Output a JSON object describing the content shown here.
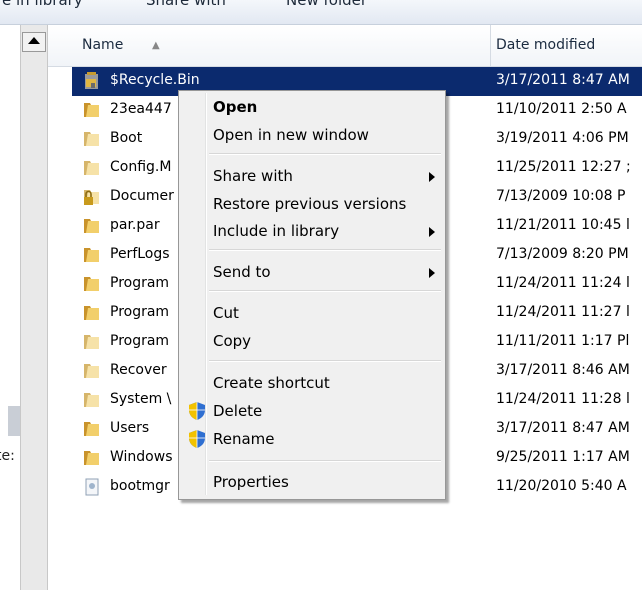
{
  "toolbar": {
    "items": [
      "e in library",
      "Share with",
      "New folder"
    ]
  },
  "left_panel": {
    "cut_text": "te:"
  },
  "header": {
    "name_label": "Name",
    "date_label": "Date modified"
  },
  "files": [
    {
      "name": "$Recycle.Bin",
      "date": "3/17/2011 8:47 AM",
      "icon": "recycle-folder-icon",
      "selected": true
    },
    {
      "name": "23ea447",
      "date": "11/10/2011 2:50 A",
      "icon": "folder-icon"
    },
    {
      "name": "Boot",
      "date": "3/19/2011 4:06 PM",
      "icon": "folder-icon"
    },
    {
      "name": "Config.M",
      "date": "11/25/2011 12:27 ;",
      "icon": "folder-icon"
    },
    {
      "name": "Documer",
      "date": "7/13/2009 10:08 P",
      "icon": "locked-folder-icon"
    },
    {
      "name": "par.par",
      "date": "11/21/2011 10:45 l",
      "icon": "folder-icon"
    },
    {
      "name": "PerfLogs",
      "date": "7/13/2009 8:20 PM",
      "icon": "folder-icon"
    },
    {
      "name": "Program",
      "date": "11/24/2011 11:24 l",
      "icon": "folder-icon"
    },
    {
      "name": "Program",
      "date": "11/24/2011 11:27 l",
      "icon": "folder-icon"
    },
    {
      "name": "Program",
      "date": "11/11/2011 1:17 Pl",
      "icon": "folder-icon"
    },
    {
      "name": "Recover",
      "date": "3/17/2011 8:46 AM",
      "icon": "folder-icon"
    },
    {
      "name": "System \\",
      "date": "11/24/2011 11:28 l",
      "icon": "folder-icon"
    },
    {
      "name": "Users",
      "date": "3/17/2011 8:47 AM",
      "icon": "folder-icon"
    },
    {
      "name": "Windows",
      "date": "9/25/2011 1:17 AM",
      "icon": "folder-icon"
    },
    {
      "name": "bootmgr",
      "date": "11/20/2010 5:40 A",
      "icon": "file-icon"
    }
  ],
  "context_menu": {
    "open": "Open",
    "open_new_window": "Open in new window",
    "share_with": "Share with",
    "restore_previous": "Restore previous versions",
    "include_in_library": "Include in library",
    "send_to": "Send to",
    "cut": "Cut",
    "copy": "Copy",
    "create_shortcut": "Create shortcut",
    "delete": "Delete",
    "rename": "Rename",
    "properties": "Properties"
  },
  "colors": {
    "selection": "#0b2a6e",
    "menu_bg": "#f0f0f0",
    "folder": "#e8b84a"
  }
}
